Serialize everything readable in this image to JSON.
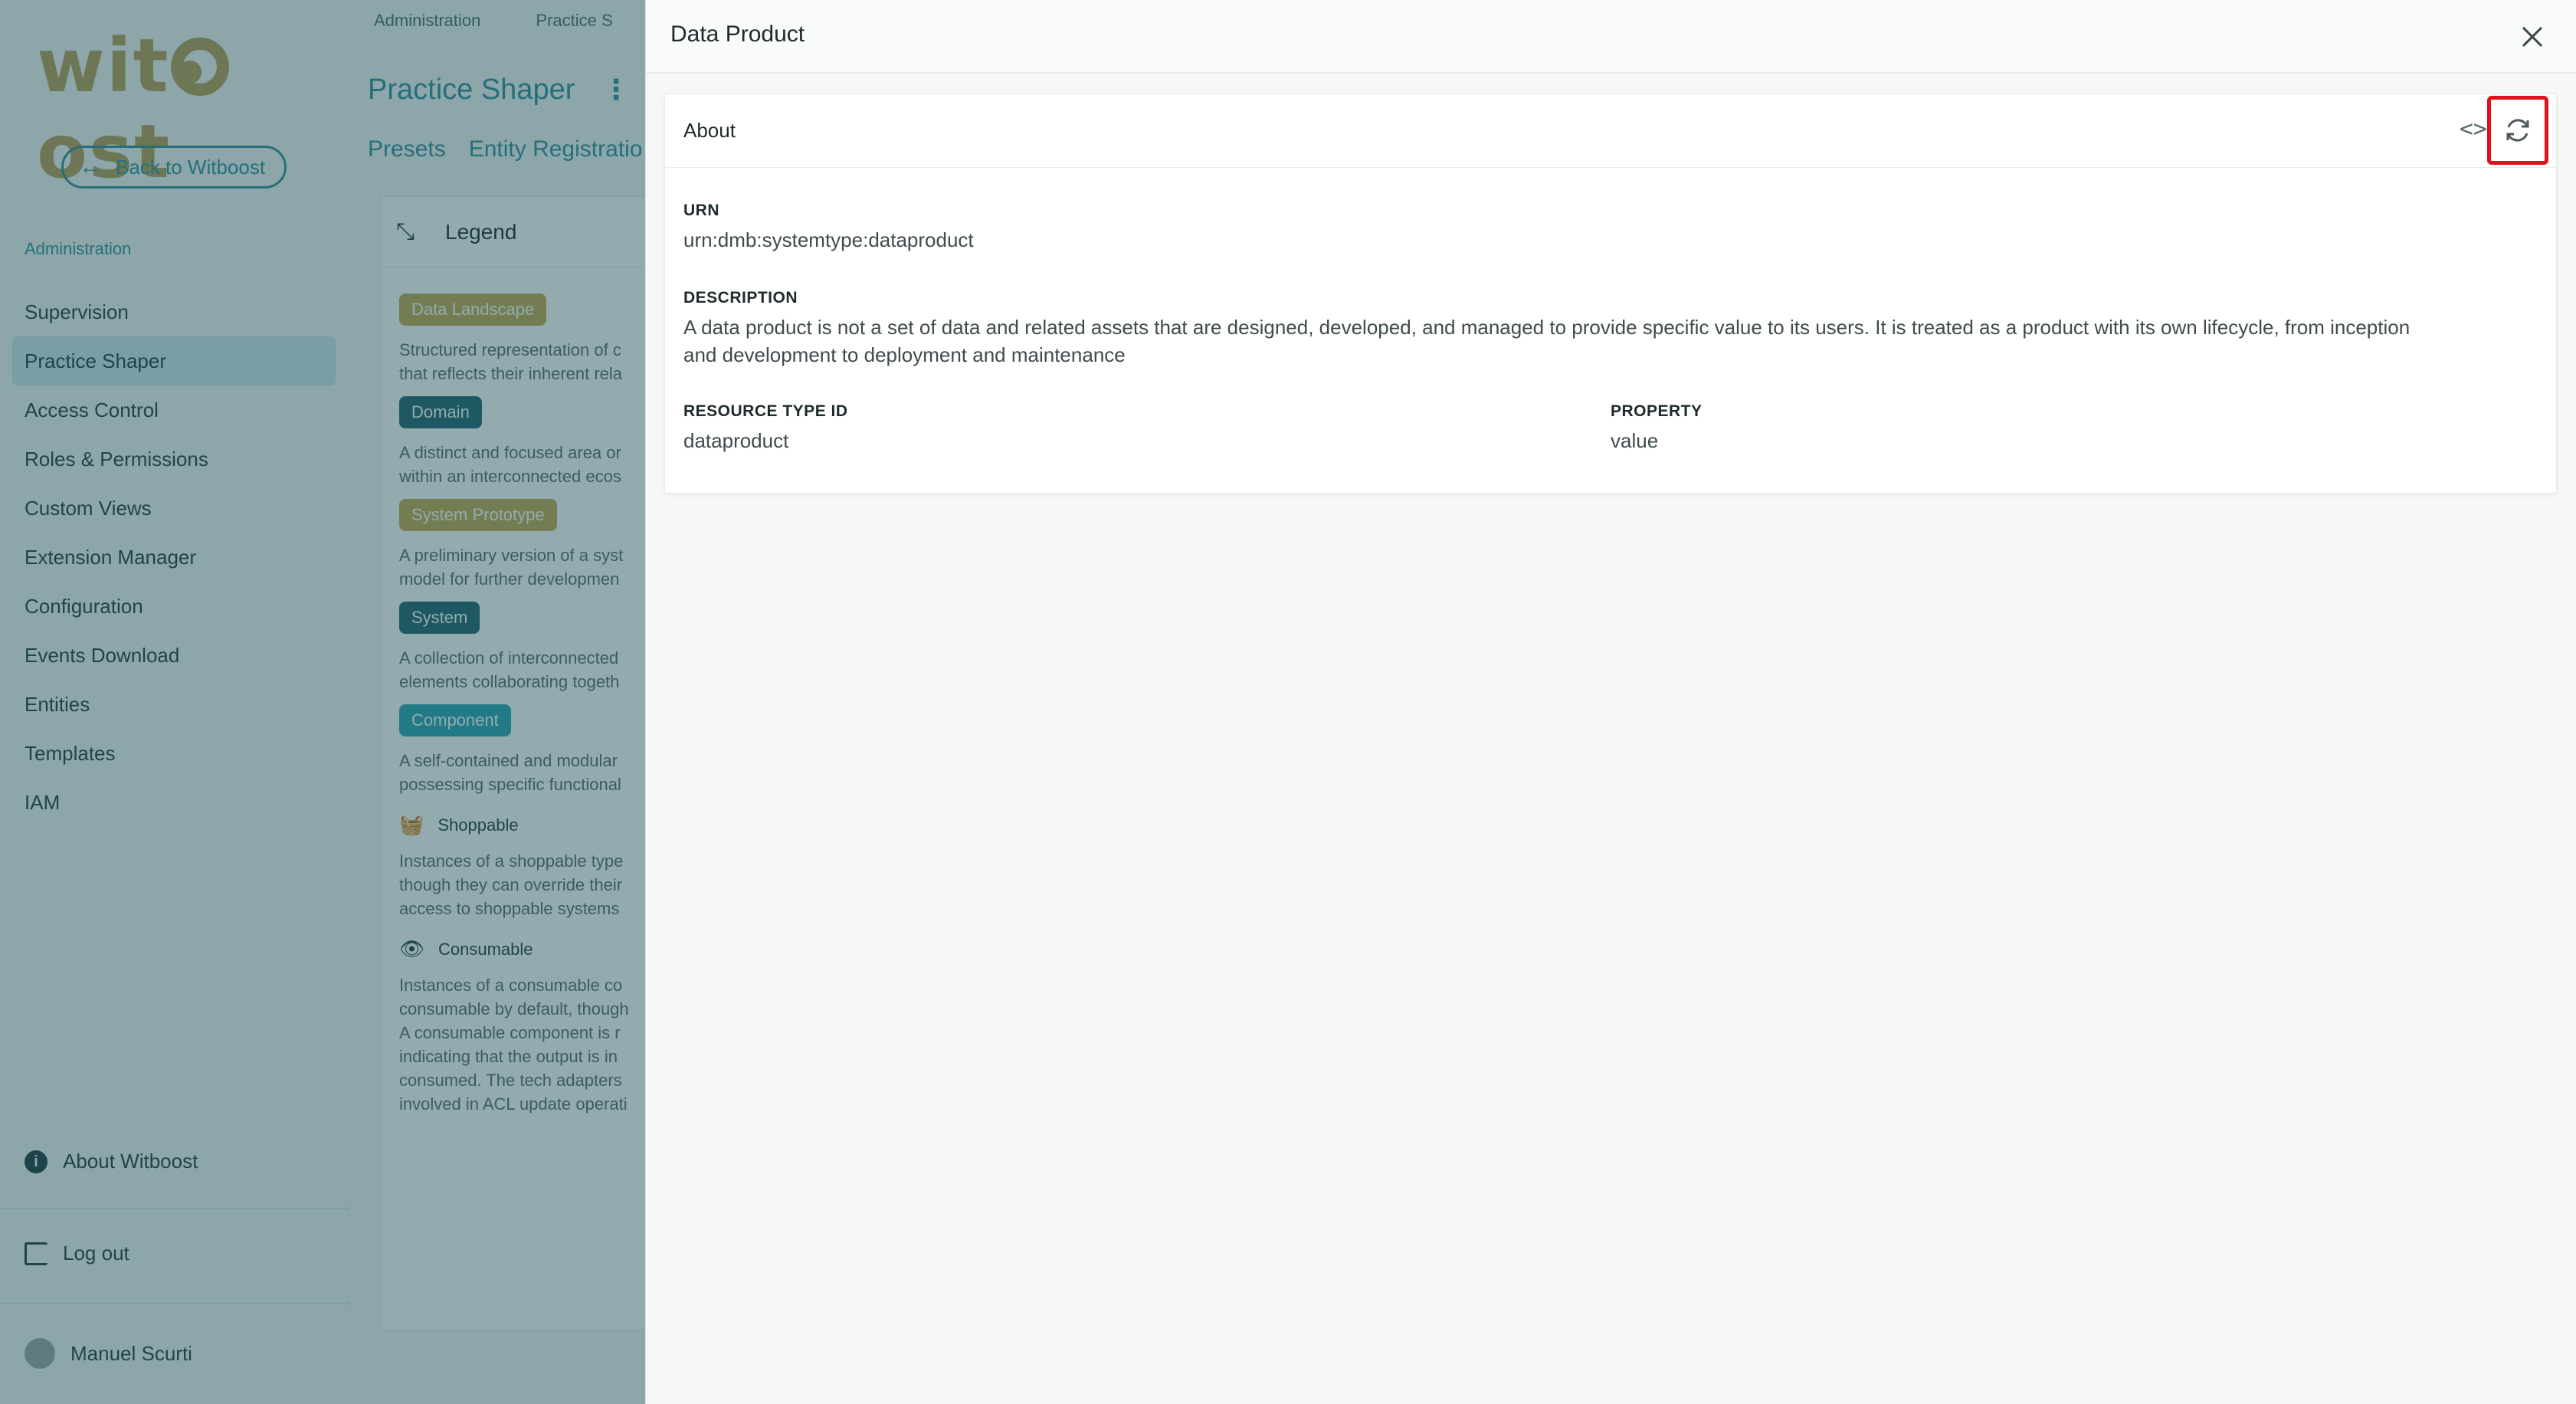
{
  "sidebar": {
    "logo_text": "witboost",
    "back_label": "Back to Witboost",
    "section_label": "Administration",
    "items": [
      {
        "label": "Supervision"
      },
      {
        "label": "Practice Shaper",
        "active": true
      },
      {
        "label": "Access Control"
      },
      {
        "label": "Roles & Permissions"
      },
      {
        "label": "Custom Views"
      },
      {
        "label": "Extension Manager"
      },
      {
        "label": "Configuration"
      },
      {
        "label": "Events Download"
      },
      {
        "label": "Entities"
      },
      {
        "label": "Templates"
      },
      {
        "label": "IAM"
      }
    ],
    "about_label": "About Witboost",
    "logout_label": "Log out",
    "user_name": "Manuel Scurti"
  },
  "main": {
    "breadcrumbs": [
      "Administration",
      "Practice S"
    ],
    "title": "Practice Shaper",
    "tabs": [
      "Presets",
      "Entity Registratio"
    ],
    "legend": {
      "title": "Legend",
      "entries": [
        {
          "chip": "Data Landscape",
          "color": "#c4a84f",
          "desc": [
            "Structured representation of c",
            "that reflects their inherent rela"
          ]
        },
        {
          "chip": "Domain",
          "color": "#1f6170",
          "desc": [
            "A distinct and focused area or",
            "within an interconnected ecos"
          ]
        },
        {
          "chip": "System Prototype",
          "color": "#c4a84f",
          "desc": [
            "A preliminary version of a syst",
            "model for further developmen"
          ]
        },
        {
          "chip": "System",
          "color": "#1f6170",
          "desc": [
            "A collection of interconnected",
            "elements collaborating togeth"
          ]
        },
        {
          "chip": "Component",
          "color": "#2aa2b4",
          "desc": [
            "A self-contained and modular",
            "possessing specific functional"
          ]
        }
      ],
      "shoppable": {
        "label": "Shoppable",
        "desc": [
          "Instances of a shoppable type",
          "though they can override their",
          "access to shoppable systems"
        ]
      },
      "consumable": {
        "label": "Consumable",
        "desc": [
          "Instances of a consumable co",
          "consumable by default, though",
          "A consumable component is r",
          "indicating that the output is in",
          "consumed. The tech adapters",
          "involved in ACL update operati"
        ]
      }
    }
  },
  "drawer": {
    "title": "Data Product",
    "about": {
      "title": "About",
      "urn_label": "URN",
      "urn_value": "urn:dmb:systemtype:dataproduct",
      "description_label": "DESCRIPTION",
      "description_value_line1": "A data product is not a set of data and related assets that are designed, developed, and managed to provide specific value to its users. It is treated as a product with its own lifecycle, from inception",
      "description_value_line2": "and development to deployment and maintenance",
      "resource_type_label": "RESOURCE TYPE ID",
      "resource_type_value": "dataproduct",
      "property_label": "PROPERTY",
      "property_value": "value"
    },
    "icons": {
      "code": "code-icon",
      "sync": "sync-icon",
      "close": "close-icon"
    },
    "highlight_color": "#e2101a"
  }
}
